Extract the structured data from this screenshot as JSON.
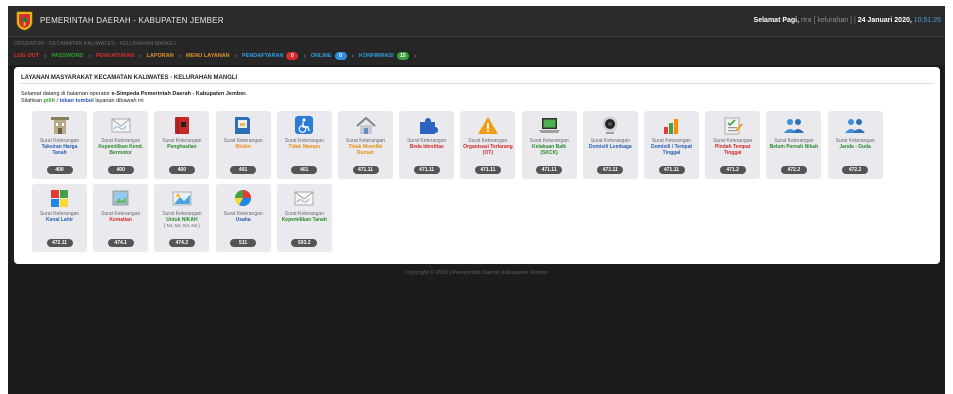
{
  "header": {
    "title": "PEMERINTAH DAERAH - KABUPATEN JEMBER",
    "greeting_prefix": "Selamat Pagi,",
    "user": " rtra [ kelurahan ] ",
    "date": "24 Januari 2020,",
    "time": " 10:51:26"
  },
  "nav": {
    "operator": "OPERATOR : KECAMATAN KALIWATES - KELURAHAN MANGLI",
    "items": [
      {
        "label": "LOG OUT",
        "color": "#e03030"
      },
      {
        "label": "PASSWORD",
        "color": "#2e9a2e"
      },
      {
        "label": "PENGATURAN",
        "color": "#d83030"
      },
      {
        "label": "LAPORAN",
        "color": "#e0902c"
      },
      {
        "label": "MENU LAYANAN",
        "color": "#e0902c"
      },
      {
        "label": "PENDAFTARAN",
        "color": "#2f9fe0",
        "badge": "0",
        "badge_color": "#d9292b"
      },
      {
        "label": "ONLINE",
        "color": "#2f9fe0",
        "badge": "0",
        "badge_color": "#2f8fe0"
      },
      {
        "label": "KONFIRMASI",
        "color": "#2f9fe0",
        "badge": "15",
        "badge_color": "#3a9e3a"
      }
    ],
    "separator": "›"
  },
  "panel": {
    "title": "LAYANAN MASYARAKAT KECAMATAN KALIWATES - KELURAHAN MANGLI",
    "welcome_a": "Selamat datang di halaman operator",
    "welcome_b": "e-Simpeda Pemerintah Daerah - Kabupaten Jember.",
    "instr_a": "Silahkan",
    "instr_b": "pilih",
    "instr_c": "/",
    "instr_d": "tekan tombol",
    "instr_e": "layanan dibawah ini"
  },
  "tiles": [
    {
      "line1": "Surat Keterangan",
      "name": "Taksiran Harga Tanah",
      "name_color": "#2a5fb0",
      "code": "400",
      "icon": "building-icon"
    },
    {
      "line1": "Surat Keterangan",
      "name": "Kepemilikan Kend. Bermotor",
      "name_color": "#2a8a2a",
      "code": "400",
      "icon": "envelope-icon"
    },
    {
      "line1": "Surat Keterangan",
      "name": "Penghasilan",
      "name_color": "#2a8a2a",
      "code": "400",
      "icon": "book-icon"
    },
    {
      "line1": "Surat Keterangan",
      "name": "Miskin",
      "name_color": "#e8901c",
      "code": "401",
      "icon": "document-icon"
    },
    {
      "line1": "Surat Keterangan",
      "name": "Tidak Mampu",
      "name_color": "#e8901c",
      "code": "401",
      "icon": "wheelchair-icon"
    },
    {
      "line1": "Surat Keterangan",
      "name": "Tidak Memiliki Rumah",
      "name_color": "#e8901c",
      "code": "471.11",
      "icon": "house-icon"
    },
    {
      "line1": "Surat Keterangan",
      "name": "Beda Identitas",
      "name_color": "#d42a2a",
      "code": "471.11",
      "icon": "puzzle-icon"
    },
    {
      "line1": "Surat Keterangan",
      "name": "Organisasi Terlarang (OT)",
      "name_color": "#d42a2a",
      "code": "471.11",
      "icon": "warning-icon"
    },
    {
      "line1": "Surat Keterangan",
      "name": "Kelakuan Baik (SKCK)",
      "name_color": "#2a8a2a",
      "code": "471.11",
      "icon": "laptop-icon"
    },
    {
      "line1": "Surat Keterangan",
      "name": "Domisili Lembaga",
      "name_color": "#2a5fb0",
      "code": "471.11",
      "icon": "webcam-icon"
    },
    {
      "line1": "Surat Keterangan",
      "name": "Domisili / Tempat Tinggal",
      "name_color": "#2a5fb0",
      "code": "471.11",
      "icon": "bar-chart-icon"
    },
    {
      "line1": "Surat Keterangan",
      "name": "Pindah Tempat Tinggal",
      "name_color": "#d42a2a",
      "code": "471.2",
      "icon": "checklist-icon"
    },
    {
      "line1": "Surat Keterangan",
      "name": "Belum Pernah Nikah",
      "name_color": "#2a8a2a",
      "code": "472.2",
      "icon": "users-icon"
    },
    {
      "line1": "Surat Keterangan",
      "name": "Janda - Duda",
      "name_color": "#2a8a2a",
      "code": "472.2",
      "icon": "users-icon"
    },
    {
      "line1": "Surat Keterangan",
      "name": "Kenal Lahir",
      "name_color": "#2a5fb0",
      "code": "472.11",
      "icon": "puzzle-pieces-icon"
    },
    {
      "line1": "Surat Keterangan",
      "name": "Kematian",
      "name_color": "#d42a2a",
      "code": "474.1",
      "icon": "gallery-icon"
    },
    {
      "line1": "Surat Keterangan",
      "name": "Untuk NIKAH",
      "sub": "[ N1, N2, N3, N4 ]",
      "name_color": "#2a8a2a",
      "code": "474.2",
      "icon": "photo-icon"
    },
    {
      "line1": "Surat Keterangan",
      "name": "Usaha",
      "name_color": "#2a5fb0",
      "code": "511",
      "icon": "pie-chart-icon"
    },
    {
      "line1": "Surat Keterangan",
      "name": "Kepemilikan Tanah",
      "name_color": "#2a8a2a",
      "code": "593.2",
      "icon": "envelope-icon"
    }
  ],
  "footer": "Copyright © 2018 | Pemerintah Daerah Kabupaten Jember"
}
